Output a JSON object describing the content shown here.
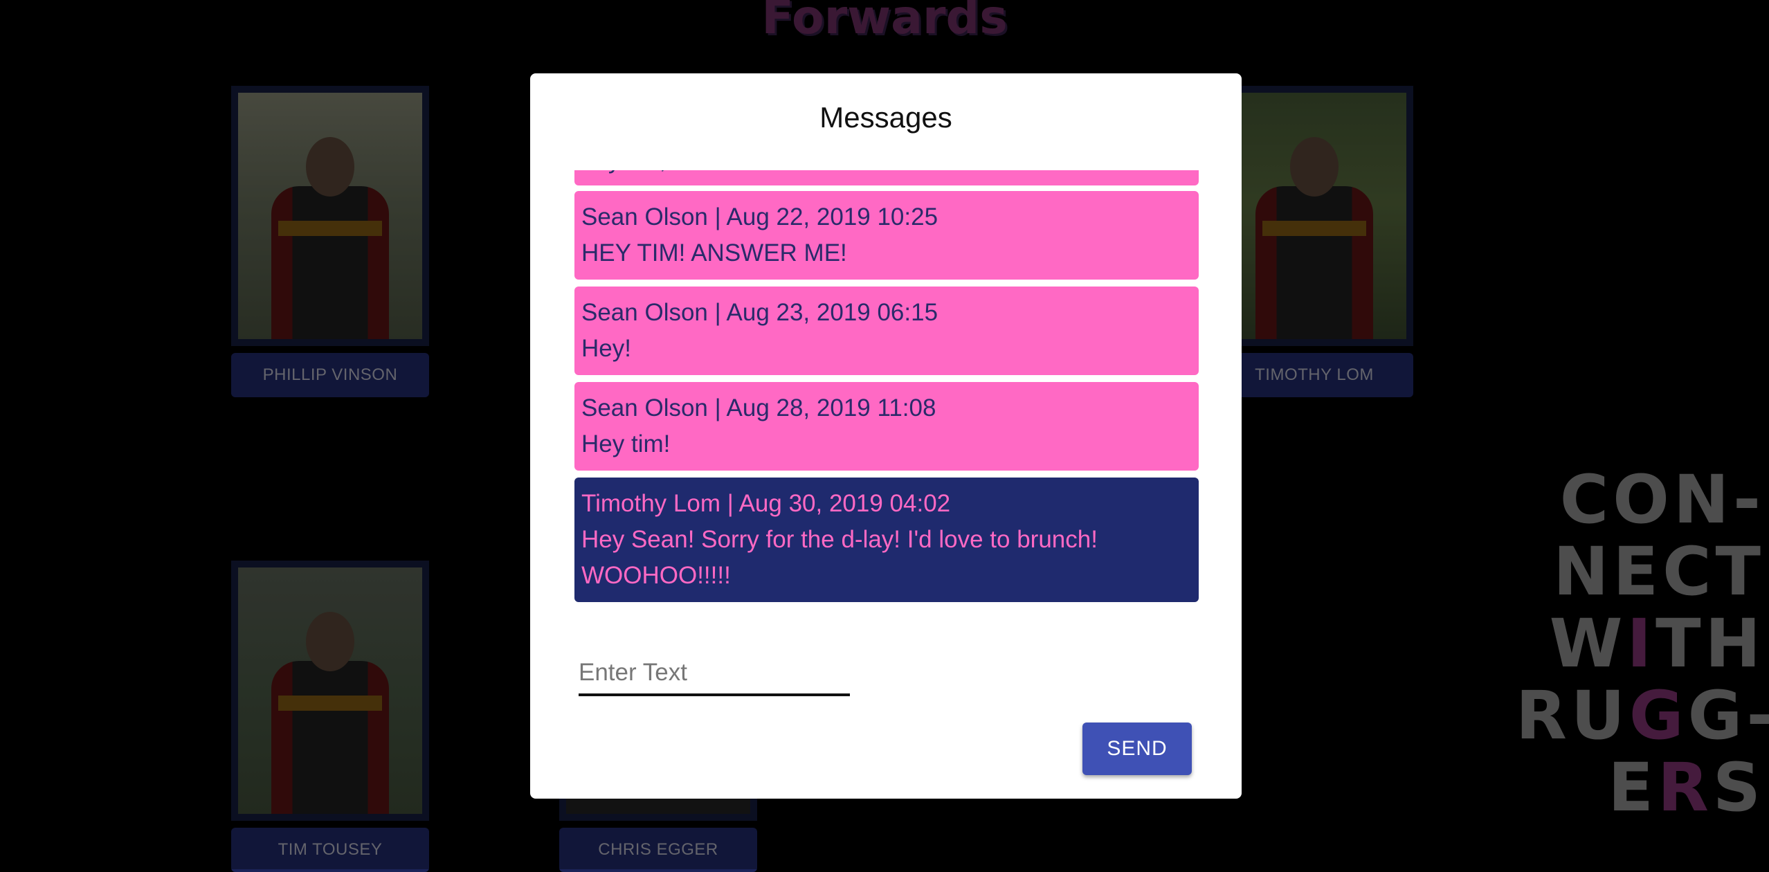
{
  "page": {
    "section_title": "Forwards",
    "players": [
      {
        "name": "PHILLIP VINSON",
        "photo": "player-photo"
      },
      {
        "name": "TIMOTHY LOM",
        "photo": "player-photo"
      },
      {
        "name": "TIM TOUSEY",
        "photo": "player-photo"
      },
      {
        "name": "CHRIS EGGER",
        "photo": "player-photo"
      }
    ],
    "logo": {
      "line1": "CON-",
      "line2": "NECT",
      "line3a": "W",
      "line3b": "I",
      "line3c": "TH",
      "line4a": "RU",
      "line4b": "G",
      "line4c": "G-",
      "line5a": "E",
      "line5b": "R",
      "line5c": "S"
    }
  },
  "modal": {
    "title": "Messages",
    "messages": [
      {
        "meta": "",
        "text": "hey tim, wanna meet for brunch!!",
        "sender": "mine"
      },
      {
        "meta": "Sean Olson | Aug 22, 2019 10:25",
        "text": "HEY TIM! ANSWER ME!",
        "sender": "mine"
      },
      {
        "meta": "Sean Olson | Aug 23, 2019 06:15",
        "text": "Hey!",
        "sender": "mine"
      },
      {
        "meta": "Sean Olson | Aug 28, 2019 11:08",
        "text": "Hey tim!",
        "sender": "mine"
      },
      {
        "meta": "Timothy Lom | Aug 30, 2019 04:02",
        "text": "Hey Sean! Sorry for the d-lay! I'd love to brunch! WOOHOO!!!!!",
        "sender": "theirs"
      }
    ],
    "input_placeholder": "Enter Text",
    "input_value": "",
    "send_label": "SEND"
  },
  "colors": {
    "mine_bg": "#ff69c4",
    "theirs_bg": "#1f2a6e",
    "send_button": "#3f51b5",
    "name_plate": "#1b2358"
  }
}
